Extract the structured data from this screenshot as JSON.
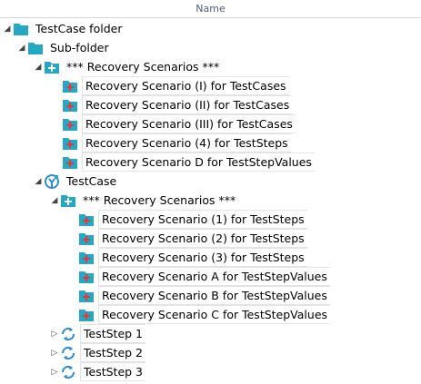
{
  "header": {
    "name_label": "Name"
  },
  "colors": {
    "folder": "#25a7c6",
    "folder_dark": "#1f8fb0",
    "plus": "#ffffff",
    "red_plus": "#e03a3a",
    "sync": "#2d8bd6"
  },
  "tree": {
    "testcase_folder": "TestCase folder",
    "sub_folder": "Sub-folder",
    "recovery_folder_1": "*** Recovery Scenarios ***",
    "rs1_items": [
      "Recovery Scenario (I) for TestCases",
      "Recovery Scenario (II) for TestCases",
      "Recovery Scenario (III) for TestCases",
      "Recovery Scenario (4) for TestSteps",
      "Recovery Scenario D for TestStepValues"
    ],
    "testcase": "TestCase",
    "recovery_folder_2": "*** Recovery Scenarios ***",
    "rs2_items": [
      "Recovery Scenario (1) for TestSteps",
      "Recovery Scenario (2) for TestSteps",
      "Recovery Scenario (3) for TestSteps",
      "Recovery Scenario A for TestStepValues",
      "Recovery Scenario B for TestStepValues",
      "Recovery Scenario C for TestStepValues"
    ],
    "teststeps": [
      "TestStep 1",
      "TestStep 2",
      "TestStep 3"
    ]
  }
}
